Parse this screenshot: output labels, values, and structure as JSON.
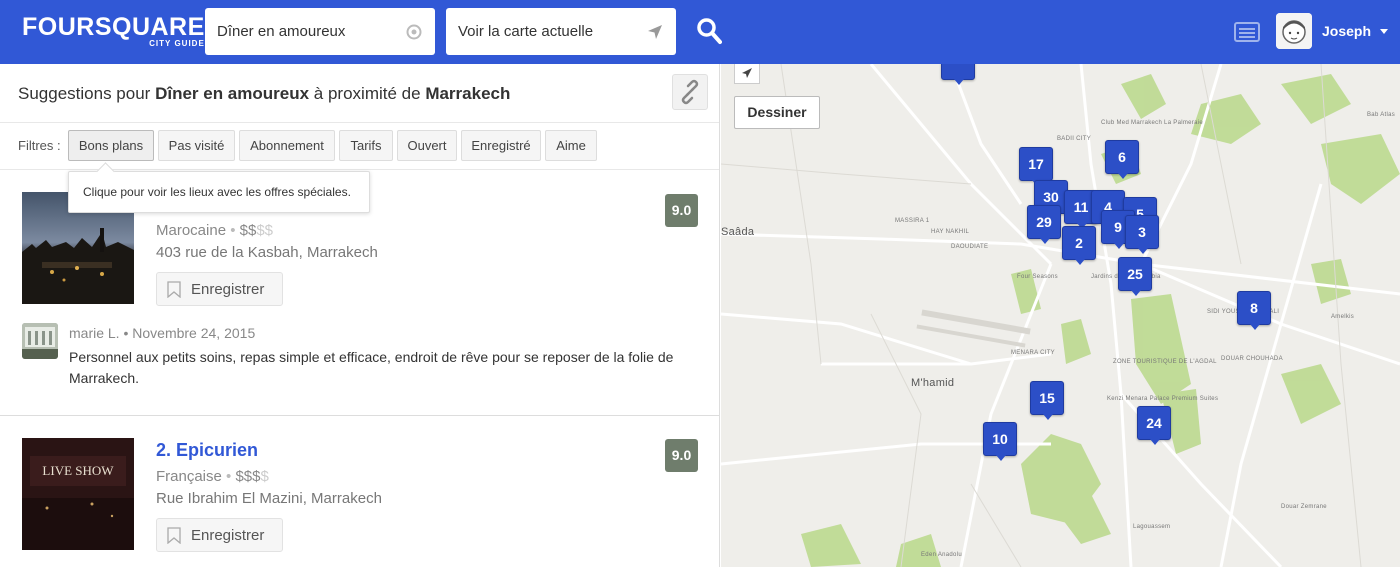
{
  "header": {
    "logo": "FOURSQUARE",
    "logo_sub": "CITY GUIDE",
    "what_value": "Dîner en amoureux",
    "where_value": "Voir la carte actuelle",
    "user_name": "Joseph",
    "brand_color": "#3158d6"
  },
  "results": {
    "prefix": "Suggestions pour",
    "query": "Dîner en amoureux",
    "middle": "à proximité de",
    "city": "Marrakech"
  },
  "filters": {
    "label": "Filtres :",
    "items": [
      "Bons plans",
      "Pas visité",
      "Abonnement",
      "Tarifs",
      "Ouvert",
      "Enregistré",
      "Aime"
    ],
    "tooltip": "Clique pour voir les lieux avec les offres spéciales."
  },
  "venues": [
    {
      "name_partial": "",
      "category": "Marocaine",
      "price": "$$",
      "price_dim": "$$",
      "address": "403 rue de la Kasbah, Marrakech",
      "save_label": "Enregistrer",
      "score": "9.0",
      "tip_user": "marie L.",
      "tip_date": "Novembre 24, 2015",
      "tip_text": "Personnel aux petits soins, repas simple et efficace, endroit de rêve pour se reposer de la folie de Marrakech."
    },
    {
      "name": "2. Epicurien",
      "category": "Française",
      "price": "$$$",
      "price_dim": "$",
      "address": "Rue Ibrahim El Mazini, Marrakech",
      "save_label": "Enregistrer",
      "score": "9.0",
      "thumb_text": "LIVE SHOW"
    }
  ],
  "map": {
    "draw_label": "Dessiner",
    "pins": [
      "17",
      "6",
      "30",
      "11",
      "4",
      "5",
      "29",
      "2",
      "3",
      "9",
      "25",
      "8",
      "15",
      "24",
      "10"
    ],
    "labels": {
      "saada": "Saâda",
      "mhamid": "M'hamid",
      "amelkis": "Amelkis",
      "agdal": "ZONE TOURISTIQUE DE L'AGDAL",
      "douar_chouhada": "DOUAR CHOUHADA",
      "lagouassem": "Lagouassem",
      "douar_zemrane": "Douar Zemrane",
      "eden_anadolu": "Eden Anadolu",
      "club_med": "Club Med Marrakech La Palmeraie",
      "baba": "Bab Atlas",
      "sidi_youssef": "SIDI YOUSSEF BEN ALI",
      "four_seasons": "Four Seasons",
      "jardins": "Jardins de la Koutoubia",
      "kenzi": "Kenzi Menara Palace Premium Suites",
      "massira": "MASSIRA 1",
      "daoudiate": "DAOUDIATE",
      "hay_nakhil": "HAY NAKHIL",
      "menara_city": "MENARA CITY",
      "badii": "BADII CITY"
    }
  }
}
